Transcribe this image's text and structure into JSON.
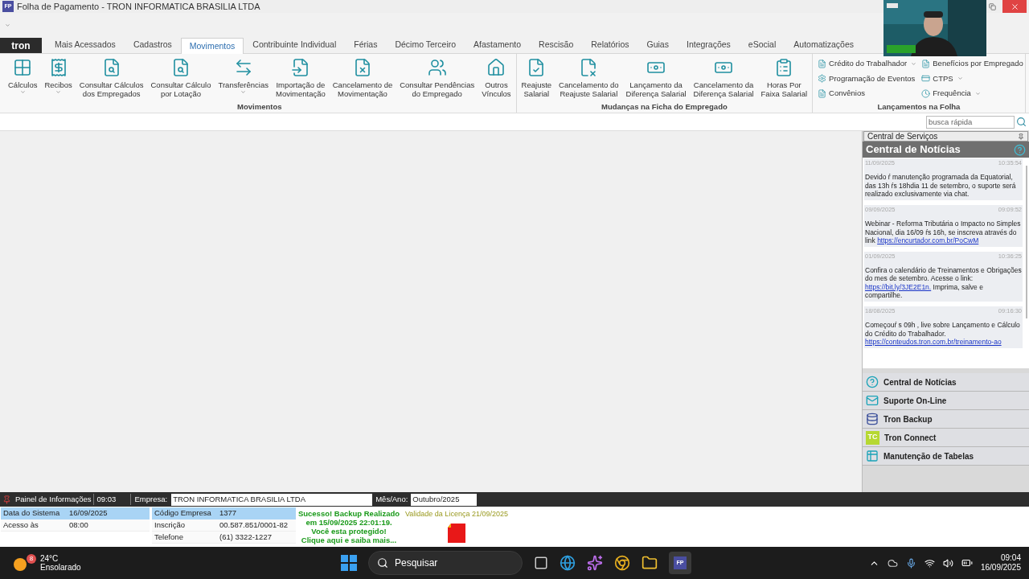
{
  "window": {
    "title": "Folha de Pagamento - TRON INFORMATICA BRASILIA LTDA",
    "app_badge": "FP"
  },
  "logo": "tron",
  "tabs": [
    {
      "label": "Mais Acessados",
      "selected": false
    },
    {
      "label": "Cadastros",
      "selected": false
    },
    {
      "label": "Movimentos",
      "selected": true
    },
    {
      "label": "Contribuinte Individual",
      "selected": false
    },
    {
      "label": "Férias",
      "selected": false
    },
    {
      "label": "Décimo Terceiro",
      "selected": false
    },
    {
      "label": "Afastamento",
      "selected": false
    },
    {
      "label": "Rescisão",
      "selected": false
    },
    {
      "label": "Relatórios",
      "selected": false
    },
    {
      "label": "Guias",
      "selected": false
    },
    {
      "label": "Integrações",
      "selected": false
    },
    {
      "label": "eSocial",
      "selected": false
    },
    {
      "label": "Automatizações",
      "selected": false
    }
  ],
  "ribbon": [
    {
      "kind": "large",
      "title": "Movimentos",
      "items": [
        {
          "label": "Cálculos",
          "dropdown": true
        },
        {
          "label": "Recibos",
          "dropdown": true
        },
        {
          "label": "Consultar Cálculos\ndos Empregados",
          "dropdown": false
        },
        {
          "label": "Consultar Cálculo\npor Lotação",
          "dropdown": false
        },
        {
          "label": "Transferências",
          "dropdown": true
        },
        {
          "label": "Importação de\nMovimentação",
          "dropdown": false
        },
        {
          "label": "Cancelamento de\nMovimentação",
          "dropdown": false
        },
        {
          "label": "Consultar Pendências\ndo Empregado",
          "dropdown": false
        },
        {
          "label": "Outros\nVínculos",
          "dropdown": false
        }
      ]
    },
    {
      "kind": "large",
      "title": "Mudanças na Ficha do Empregado",
      "items": [
        {
          "label": "Reajuste\nSalarial",
          "dropdown": false
        },
        {
          "label": "Cancelamento do\nReajuste Salarial",
          "dropdown": false
        },
        {
          "label": "Lançamento da\nDiferença Salarial",
          "dropdown": false
        },
        {
          "label": "Cancelamento da\nDiferença Salarial",
          "dropdown": false
        },
        {
          "label": "Horas Por\nFaixa Salarial",
          "dropdown": false
        }
      ]
    },
    {
      "kind": "small",
      "title": "Lançamentos na Folha",
      "items": [
        {
          "label": "Crédito do Trabalhador",
          "dropdown": true
        },
        {
          "label": "Programação de Eventos",
          "dropdown": false
        },
        {
          "label": "Convênios",
          "dropdown": false
        },
        {
          "label": "Benefícios por Empregado",
          "dropdown": false
        },
        {
          "label": "CTPS",
          "dropdown": true
        },
        {
          "label": "Frequência",
          "dropdown": true
        }
      ]
    }
  ],
  "search": {
    "placeholder": "busca rápida"
  },
  "services_panel": {
    "header": "Central de Serviços",
    "title": "Central de Notícias",
    "news": [
      {
        "date": "11/09/2025",
        "time": "10:35:54",
        "text": "Devido ŕ manutenção programada da Equatorial, das 13h ŕs 18hdia 11 de setembro, o suporte será realizado exclusivamente via chat."
      },
      {
        "date": "09/09/2025",
        "time": "09:09:52",
        "text": "Webinar - Reforma Tributária o Impacto no Simples Nacional, dia 16/09 ŕs 16h, se inscreva através do link",
        "link": "https://encurtador.com.br/PoCwM"
      },
      {
        "date": "01/09/2025",
        "time": "10:36:25",
        "text": "Confira o calendário de Treinamentos e Obrigações do mes de setembro. Acesse o link:",
        "link": "https://bit.ly/3JE2E1n.",
        "after": "Imprima, salve e compartilhe."
      },
      {
        "date": "18/08/2025",
        "time": "09:16:30",
        "text": "Começouŕ s 09h , live sobre Lançamento e Cálculo do Crédito do Trabalhador.",
        "link": "https://conteudos.tron.com.br/treinamento-ao"
      }
    ],
    "services": [
      {
        "label": "Central de Notícias",
        "kind": "help"
      },
      {
        "label": "Suporte On-Line",
        "kind": "mail"
      },
      {
        "label": "Tron Backup",
        "kind": "backup"
      },
      {
        "label": "Tron Connect",
        "kind": "connect",
        "icon_text": "TC"
      },
      {
        "label": "Manutenção de Tabelas",
        "kind": "table"
      }
    ]
  },
  "info_bar": {
    "label": "Painel de Informações",
    "time": "09:03",
    "company_label": "Empresa:",
    "company": "TRON INFORMATICA BRASILIA LTDA",
    "period_label": "Mês/Ano:",
    "period": "Outubro/2025"
  },
  "info": {
    "left": [
      {
        "label": "Data do Sistema",
        "value": "16/09/2025",
        "selected": true
      },
      {
        "label": "Acesso às",
        "value": "08:00",
        "selected": false
      }
    ],
    "middle": [
      {
        "label": "Código Empresa",
        "value": "1377",
        "selected": true
      },
      {
        "label": "Inscrição",
        "value": "00.587.851/0001-82",
        "selected": false
      },
      {
        "label": "Telefone",
        "value": "(61) 3322-1227",
        "selected": false
      }
    ],
    "backup": "Sucesso! Backup Realizado\nem 15/09/2025 22:01:19.\nVocê esta protegido!\nClique aqui e saiba mais...",
    "license": "Validade da Licença 21/09/2025"
  },
  "taskbar": {
    "weather_badge": "8",
    "temperature": "24°C",
    "condition": "Ensolarado",
    "search": "Pesquisar",
    "app_badge": "FP",
    "time": "09:04",
    "date": "16/09/2025"
  }
}
